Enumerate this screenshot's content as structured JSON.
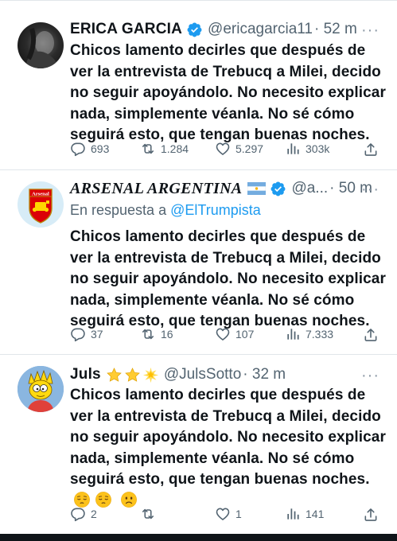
{
  "tweets": [
    {
      "name": "ERICA GARCIA",
      "handle": "@ericagarcia11",
      "time": "· 52 m",
      "reply_prefix": "",
      "reply_handle": "",
      "text": "Chicos lamento decirles que después de ver la entrevista de Trebucq a Milei, decido no seguir apoyándolo. No necesito explicar nada, simplemente véanla. No sé cómo seguirá esto, que tengan buenas noches.",
      "replies": "693",
      "retweets": "1.284",
      "likes": "5.297",
      "views": "303k",
      "more": "···",
      "verified": true
    },
    {
      "name": "ARSENAL ARGENTINA",
      "handle": "@a...",
      "time": "· 50 m",
      "reply_prefix": "En respuesta a ",
      "reply_handle": "@ElTrumpista",
      "text": "Chicos lamento decirles que después de ver la entrevista de Trebucq a Milei, decido no seguir apoyándolo. No necesito explicar nada, simplemente véanla. No sé cómo seguirá esto, que tengan buenas noches.",
      "replies": "37",
      "retweets": "16",
      "likes": "107",
      "views": "7.333",
      "more": "···",
      "verified": true,
      "flag": "argentina-flag-icon",
      "avatar_text": "Arsenal"
    },
    {
      "name": "Juls",
      "handle": "@JulsSotto",
      "time": "· 32 m",
      "reply_prefix": "",
      "reply_handle": "",
      "text": "Chicos lamento decirles que después de ver la entrevista de Trebucq a Milei, decido no seguir apoyándolo. No necesito explicar nada, simplemente véanla. No sé cómo seguirá esto, que tengan buenas noches.",
      "replies": "2",
      "retweets": "",
      "likes": "1",
      "views": "141",
      "more": "···",
      "verified": false,
      "name_emojis": [
        "star-icon",
        "star-icon",
        "glowing-star-icon"
      ],
      "text_emojis": [
        "pensive-face-icon",
        "pensive-face-icon",
        "slightly-frowning-face-icon"
      ]
    }
  ],
  "colors": {
    "text": "#0f1419",
    "secondary": "#536471",
    "link": "#1d9bf0",
    "verified": "#1d9bf0",
    "separator": "#e1e6ea"
  }
}
